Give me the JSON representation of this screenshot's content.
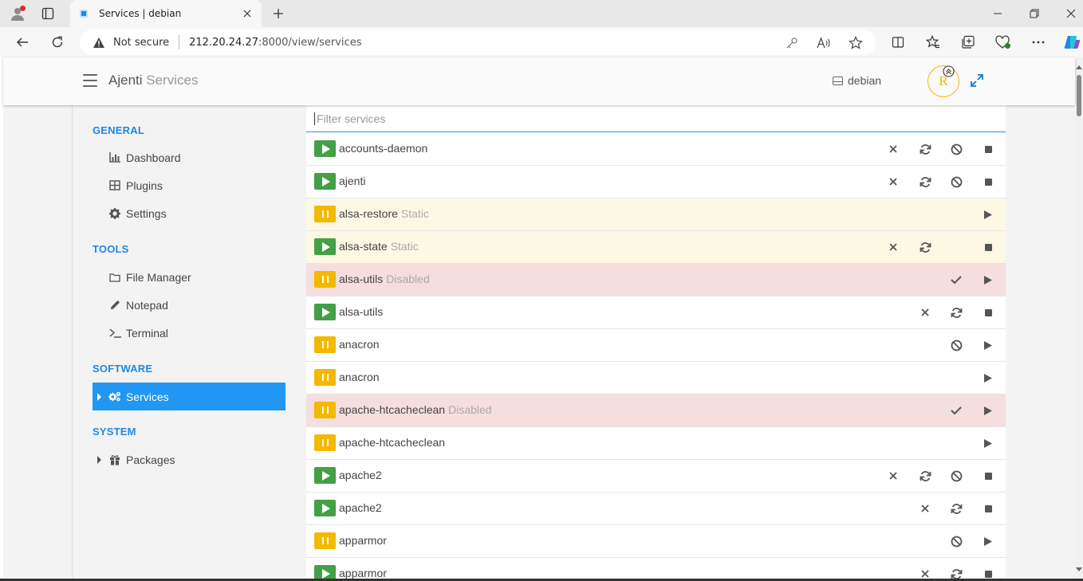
{
  "browser": {
    "tab_title": "Services | debian",
    "security_label": "Not secure",
    "url_host": "212.20.24.27",
    "url_path": ":8000/view/services"
  },
  "app": {
    "brand": "Ajenti",
    "page": "Services",
    "host": "debian",
    "avatar_initial": "R"
  },
  "sidebar": {
    "sections": [
      {
        "title": "GENERAL",
        "items": [
          {
            "label": "Dashboard",
            "icon": "chart-icon"
          },
          {
            "label": "Plugins",
            "icon": "grid-icon"
          },
          {
            "label": "Settings",
            "icon": "gear-icon"
          }
        ]
      },
      {
        "title": "TOOLS",
        "items": [
          {
            "label": "File Manager",
            "icon": "folder-icon"
          },
          {
            "label": "Notepad",
            "icon": "pencil-icon"
          },
          {
            "label": "Terminal",
            "icon": "terminal-icon"
          }
        ]
      },
      {
        "title": "SOFTWARE",
        "items": [
          {
            "label": "Services",
            "icon": "cogs-icon",
            "active": true
          }
        ]
      },
      {
        "title": "SYSTEM",
        "items": [
          {
            "label": "Packages",
            "icon": "gift-icon"
          }
        ]
      }
    ]
  },
  "filter": {
    "placeholder": "Filter services"
  },
  "services": [
    {
      "name": "accounts-daemon",
      "tag": "",
      "state": "running",
      "row": "normal",
      "actions": [
        "kill",
        "restart",
        "disable",
        "stop"
      ]
    },
    {
      "name": "ajenti",
      "tag": "",
      "state": "running",
      "row": "normal",
      "actions": [
        "kill",
        "restart",
        "disable",
        "stop"
      ]
    },
    {
      "name": "alsa-restore",
      "tag": "Static",
      "state": "stopped",
      "row": "static",
      "actions": [
        "start"
      ]
    },
    {
      "name": "alsa-state",
      "tag": "Static",
      "state": "running",
      "row": "static",
      "actions": [
        "kill",
        "restart",
        "",
        "stop"
      ]
    },
    {
      "name": "alsa-utils",
      "tag": "Disabled",
      "state": "stopped",
      "row": "disabled",
      "actions": [
        "enable",
        "start"
      ]
    },
    {
      "name": "alsa-utils",
      "tag": "",
      "state": "running",
      "row": "normal",
      "actions": [
        "kill",
        "restart",
        "stop"
      ]
    },
    {
      "name": "anacron",
      "tag": "",
      "state": "stopped",
      "row": "normal",
      "actions": [
        "disable",
        "start"
      ]
    },
    {
      "name": "anacron",
      "tag": "",
      "state": "stopped",
      "row": "normal",
      "actions": [
        "start"
      ]
    },
    {
      "name": "apache-htcacheclean",
      "tag": "Disabled",
      "state": "stopped",
      "row": "disabled",
      "actions": [
        "enable",
        "start"
      ]
    },
    {
      "name": "apache-htcacheclean",
      "tag": "",
      "state": "stopped",
      "row": "normal",
      "actions": [
        "start"
      ]
    },
    {
      "name": "apache2",
      "tag": "",
      "state": "running",
      "row": "normal",
      "actions": [
        "kill",
        "restart",
        "disable",
        "stop"
      ]
    },
    {
      "name": "apache2",
      "tag": "",
      "state": "running",
      "row": "normal",
      "actions": [
        "kill",
        "restart",
        "stop"
      ]
    },
    {
      "name": "apparmor",
      "tag": "",
      "state": "stopped",
      "row": "normal",
      "actions": [
        "disable",
        "start"
      ]
    },
    {
      "name": "apparmor",
      "tag": "",
      "state": "running",
      "row": "normal",
      "actions": [
        "kill",
        "restart",
        "stop"
      ]
    }
  ],
  "colors": {
    "accent": "#2196f3",
    "running": "#43a047",
    "stopped": "#f5b800",
    "static_row": "#fdf8e4",
    "disabled_row": "#f5dede"
  }
}
